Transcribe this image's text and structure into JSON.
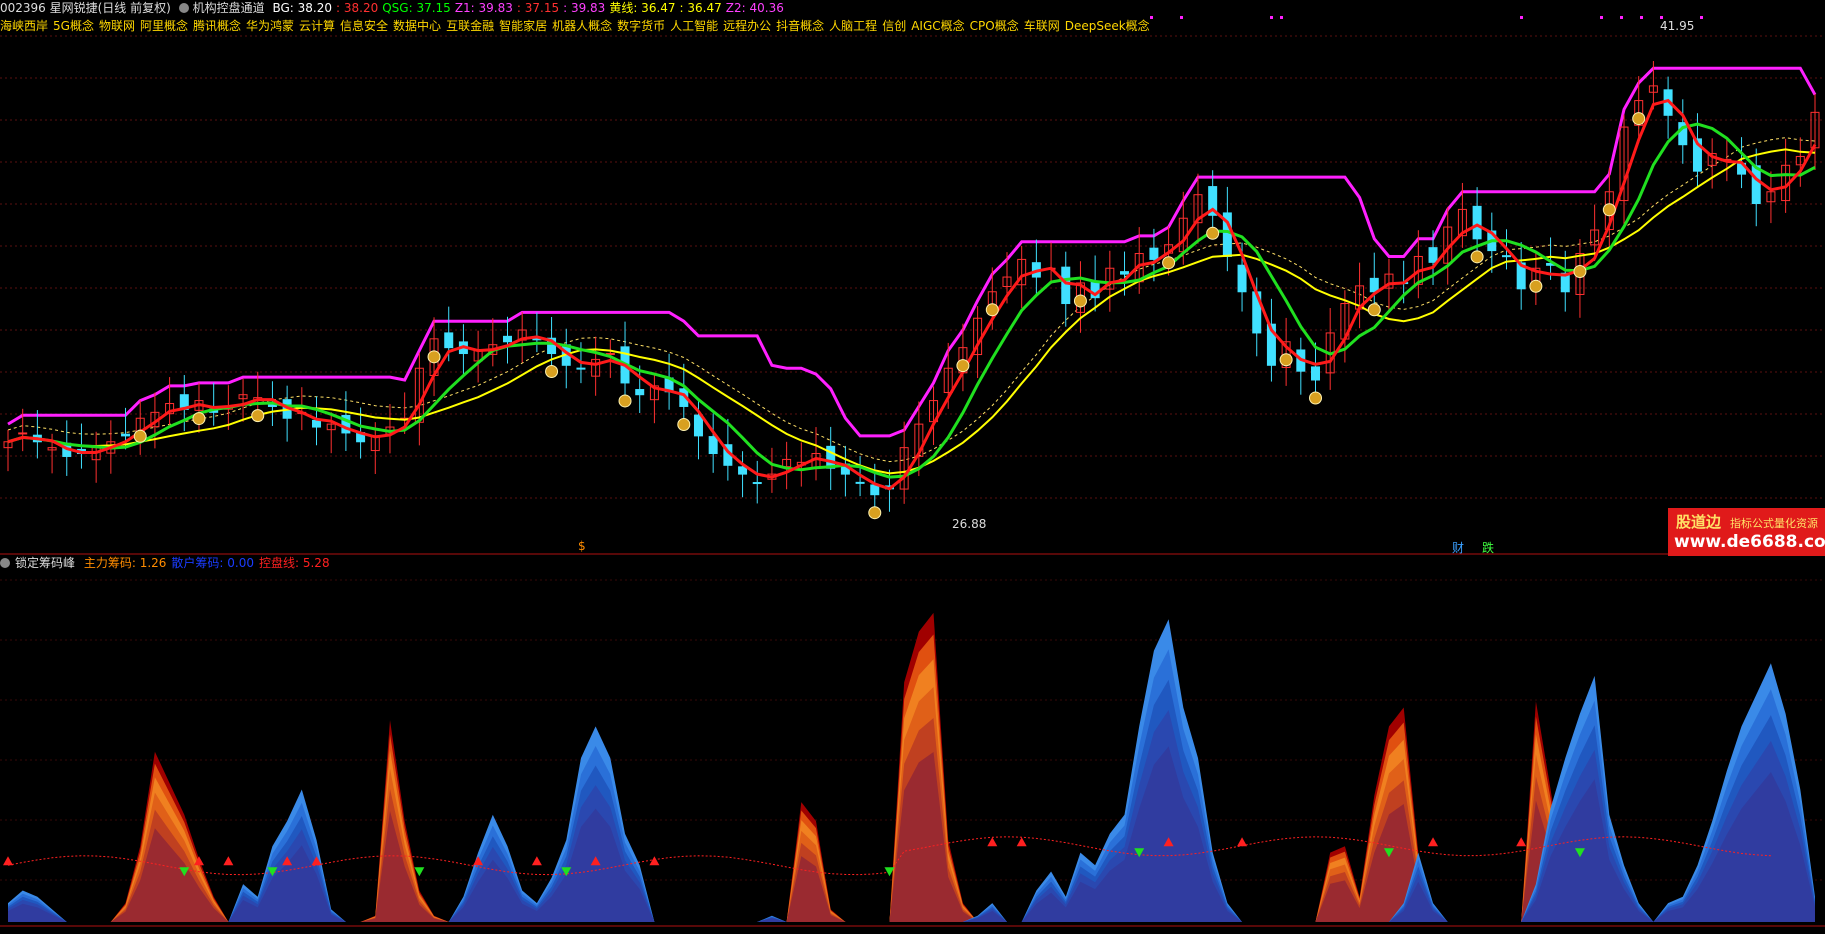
{
  "header": {
    "stock": "002396 星网锐捷(日线 前复权)",
    "indicator_name": "机构控盘通道",
    "items": [
      {
        "label": "BG: 38.20",
        "color": "#ffffff"
      },
      {
        "label": ": 38.20",
        "color": "#ff3030"
      },
      {
        "label": "QSG: 37.15",
        "color": "#00ff00"
      },
      {
        "label": "Z1: 39.83",
        "color": "#ff40ff"
      },
      {
        "label": ": 37.15",
        "color": "#ff3030"
      },
      {
        "label": ": 39.83",
        "color": "#ff40ff"
      },
      {
        "label": "黄线: 36.47",
        "color": "#ffff00"
      },
      {
        "label": ": 36.47",
        "color": "#ffff00"
      },
      {
        "label": "Z2: 40.36",
        "color": "#ff40ff"
      }
    ]
  },
  "concepts": [
    "海峡西岸",
    "5G概念",
    "物联网",
    "阿里概念",
    "腾讯概念",
    "华为鸿蒙",
    "云计算",
    "信息安全",
    "数据中心",
    "互联金融",
    "智能家居",
    "机器人概念",
    "数字货币",
    "人工智能",
    "远程办公",
    "抖音概念",
    "人脑工程",
    "信创",
    "AIGC概念",
    "CPO概念",
    "车联网",
    "DeepSeek概念"
  ],
  "price_labels": {
    "high": "41.95",
    "low": "26.88"
  },
  "sub_header": {
    "name": "锁定筹码峰",
    "items": [
      {
        "label": "主力筹码: 1.26",
        "color": "#ff8c00"
      },
      {
        "label": "散户筹码: 0.00",
        "color": "#1a3cff"
      },
      {
        "label": "控盘线: 5.28",
        "color": "#ff2020"
      }
    ]
  },
  "event_markers": [
    {
      "text": "$",
      "color": "#ff8c00"
    },
    {
      "text": "财",
      "color": "#3aa0ff"
    },
    {
      "text": "跌",
      "color": "#40ff40"
    }
  ],
  "watermark": {
    "brand": "股道边",
    "tagline": "指标公式量化资源",
    "url": "www.de6688.com"
  },
  "colors": {
    "up": "#ff3030",
    "down": "#40e0ff",
    "ma_red": "#ff1a1a",
    "ma_green": "#20e020",
    "ma_yellow": "#ffff00",
    "channel": "#ff20ff"
  },
  "chart_data": {
    "type": "candlestick",
    "ylim": [
      26.0,
      43.0
    ],
    "close": [
      29.0,
      29.3,
      29.0,
      28.8,
      28.5,
      28.6,
      28.8,
      29.0,
      29.2,
      29.8,
      30.0,
      30.3,
      30.1,
      30.4,
      30.0,
      30.2,
      30.6,
      30.5,
      30.2,
      29.8,
      30.0,
      29.5,
      29.6,
      29.3,
      29.0,
      29.2,
      29.5,
      29.8,
      31.5,
      32.5,
      32.2,
      32.0,
      32.1,
      32.3,
      32.4,
      32.8,
      32.5,
      32.0,
      31.6,
      31.5,
      31.8,
      32.0,
      31.0,
      30.6,
      30.9,
      30.7,
      30.2,
      29.2,
      28.6,
      28.2,
      27.9,
      27.6,
      27.9,
      28.4,
      28.3,
      28.6,
      28.1,
      27.9,
      27.6,
      27.2,
      27.4,
      28.8,
      29.6,
      30.4,
      31.5,
      32.2,
      33.2,
      34.1,
      34.6,
      35.2,
      34.6,
      34.9,
      33.7,
      34.4,
      33.9,
      34.9,
      34.7,
      35.4,
      35.2,
      35.7,
      36.6,
      37.4,
      36.7,
      35.3,
      34.1,
      32.7,
      31.6,
      32.4,
      31.4,
      31.1,
      32.7,
      33.7,
      34.3,
      34.1,
      34.7,
      34.4,
      35.3,
      35.1,
      36.3,
      36.9,
      35.9,
      35.5,
      35.3,
      34.2,
      34.9,
      35.0,
      34.1,
      35.4,
      36.2,
      37.5,
      39.7,
      40.6,
      41.1,
      40.1,
      39.1,
      38.2,
      38.8,
      38.6,
      38.1,
      37.1,
      37.5,
      38.4,
      38.7,
      40.2
    ],
    "ma_lines": [
      "BG",
      "QSG",
      "黄线",
      "Z1",
      "Z2"
    ],
    "sub_chart": {
      "type": "area",
      "series": [
        "主力筹码",
        "散户筹码",
        "控盘线"
      ],
      "main": [
        0,
        0,
        0,
        0,
        0,
        0,
        0,
        0,
        0.3,
        1.2,
        2.7,
        2.2,
        1.7,
        1.0,
        0.4,
        0,
        0,
        0,
        0,
        0,
        0,
        0,
        0,
        0,
        0,
        0.1,
        3.2,
        1.6,
        0.5,
        0.1,
        0,
        0,
        0,
        0,
        0,
        0,
        0,
        0,
        0,
        0.6,
        0,
        0,
        0,
        0,
        0,
        0,
        0,
        0,
        0,
        0,
        0,
        0,
        0,
        0,
        1.9,
        1.6,
        0.2,
        0,
        0,
        0,
        0,
        3.8,
        4.6,
        4.9,
        1.3,
        0.3,
        0,
        0,
        0,
        0,
        0,
        0,
        0,
        0,
        0,
        0,
        0,
        0,
        0,
        0,
        0,
        0,
        0,
        0,
        0,
        0,
        0,
        0,
        0,
        0,
        1.1,
        1.2,
        0.4,
        2.0,
        3.1,
        3.4,
        1.1,
        0,
        0,
        0,
        0,
        0,
        0,
        0,
        3.5,
        2.1,
        0.6,
        0,
        0,
        0,
        0,
        0,
        0,
        0,
        0,
        0,
        0,
        0,
        0,
        0,
        0
      ],
      "retail": [
        0.3,
        0.5,
        0.4,
        0.2,
        0,
        0,
        0,
        0,
        0,
        0,
        0,
        0,
        0,
        0,
        0,
        0,
        0.6,
        0.4,
        1.2,
        1.6,
        2.1,
        1.3,
        0.2,
        0,
        0,
        0,
        0,
        0,
        0,
        0,
        0,
        0.4,
        1.1,
        1.7,
        1.2,
        0.5,
        0.3,
        0.7,
        1.3,
        2.6,
        3.1,
        2.6,
        1.4,
        0.9,
        0,
        0,
        0,
        0,
        0,
        0,
        0,
        0,
        0.1,
        0,
        0,
        0,
        0,
        0,
        0,
        0,
        0,
        0,
        0,
        0,
        0,
        0,
        0.1,
        0.3,
        0,
        0,
        0.5,
        0.8,
        0.4,
        1.1,
        0.9,
        1.4,
        1.7,
        3.1,
        4.3,
        4.8,
        3.4,
        2.6,
        1.1,
        0.3,
        0,
        0,
        0,
        0,
        0,
        0,
        0,
        0,
        0,
        0,
        0,
        0.3,
        1.1,
        0.3,
        0,
        0,
        0,
        0,
        0,
        0,
        0.6,
        1.8,
        2.6,
        3.3,
        3.9,
        1.7,
        0.9,
        0.3,
        0,
        0.3,
        0.4,
        0.9,
        1.6,
        2.4,
        3.1,
        3.6,
        4.1,
        3.3,
        2.1,
        0.4
      ]
    }
  }
}
